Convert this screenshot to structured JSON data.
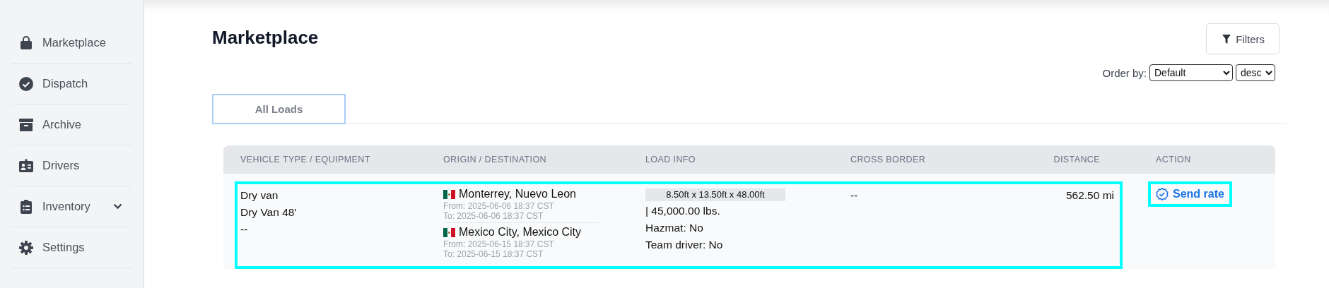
{
  "sidebar": {
    "items": [
      {
        "label": "Marketplace",
        "kind": "link"
      },
      {
        "label": "Dispatch",
        "kind": "link"
      },
      {
        "label": "Archive",
        "kind": "link"
      },
      {
        "label": "Drivers",
        "kind": "link"
      },
      {
        "label": "Inventory",
        "kind": "expandable"
      },
      {
        "label": "Settings",
        "kind": "link"
      }
    ]
  },
  "page": {
    "title": "Marketplace",
    "filters_button": "Filters",
    "order_by": {
      "label": "Order by:",
      "field": "Default",
      "direction": "desc"
    }
  },
  "tabs": [
    {
      "label": "All Loads",
      "selected": true
    }
  ],
  "table": {
    "columns": [
      "VEHICLE TYPE / EQUIPMENT",
      "ORIGIN / DESTINATION",
      "LOAD INFO",
      "CROSS BORDER",
      "DISTANCE",
      "ACTION"
    ],
    "rows": [
      {
        "highlighted": true,
        "vehicle_type": "Dry van",
        "equipment": "Dry Van 48'",
        "vehicle_note": "--",
        "origin": {
          "city": "Monterrey, Nuevo Leon",
          "from": "From: 2025-06-06 18:37 CST",
          "to": "To: 2025-06-06 18:37 CST"
        },
        "destination": {
          "city": "Mexico City, Mexico City",
          "from": "From: 2025-06-15 18:37 CST",
          "to": "To: 2025-06-15 18:37 CST"
        },
        "dimensions": "8.50ft x 13.50ft x 48.00ft",
        "weight": "| 45,000.00 lbs.",
        "hazmat": "Hazmat: No",
        "team_driver": "Team driver: No",
        "cross_border": "--",
        "distance": "562.50 mi",
        "action": {
          "label": "Send rate",
          "highlighted": true
        }
      }
    ]
  }
}
